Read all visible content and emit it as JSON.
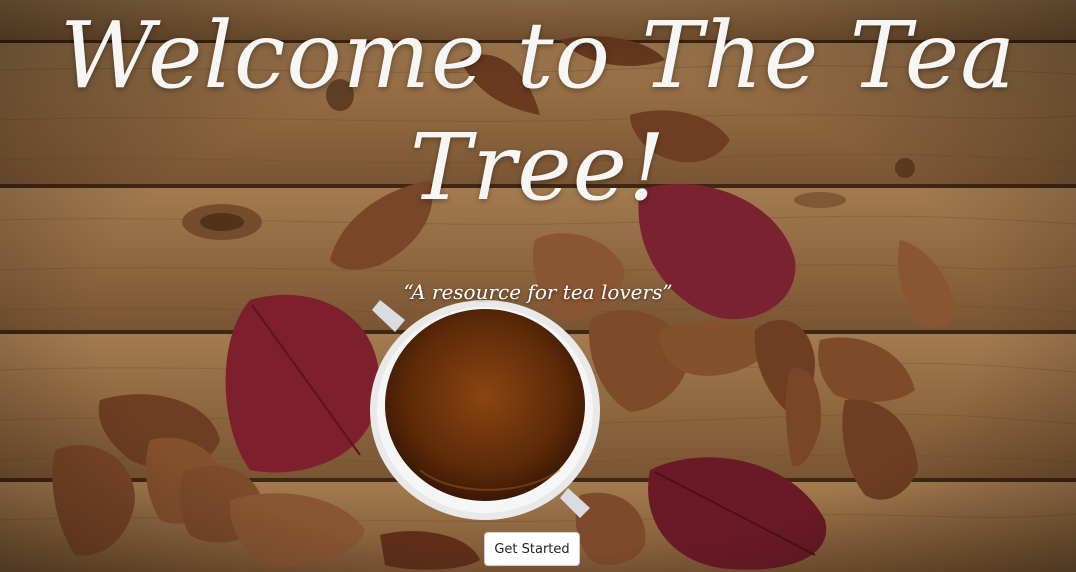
{
  "hero": {
    "title": "Welcome to The Tea Tree!",
    "tagline": "“A resource for tea lovers”",
    "cta_label": "Get Started"
  },
  "background": {
    "description_icon": "tea-cup-on-wooden-table-with-autumn-leaves",
    "wood_color": "#9a7248",
    "wood_dark": "#5d3f24",
    "tea_color": "#7a3a12",
    "cup_color": "#f3f3f3",
    "leaf_red": "#7e1f2d",
    "leaf_brown": "#7a4628"
  }
}
